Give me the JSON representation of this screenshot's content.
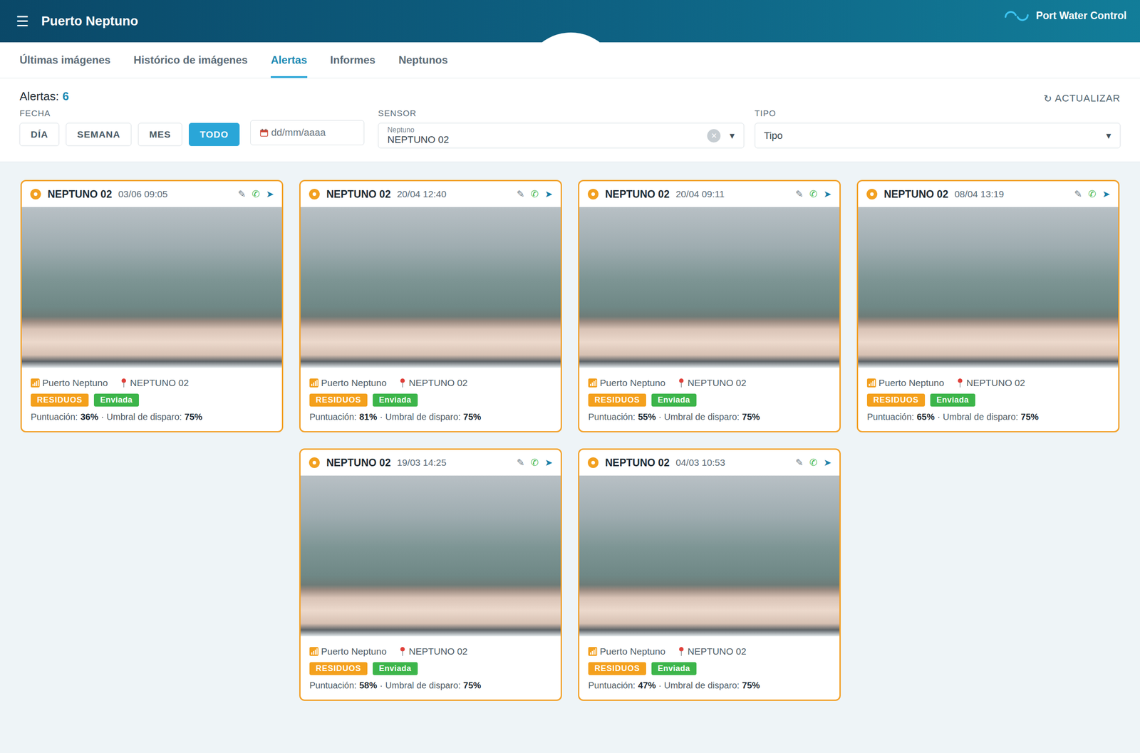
{
  "header": {
    "menu_icon": "☰",
    "title": "Puerto Neptuno",
    "brand": "Port Water Control"
  },
  "tabs": [
    {
      "label": "Últimas imágenes",
      "selected": false
    },
    {
      "label": "Histórico de imágenes",
      "selected": false
    },
    {
      "label": "Alertas",
      "selected": true
    },
    {
      "label": "Informes",
      "selected": false
    },
    {
      "label": "Neptunos",
      "selected": false
    }
  ],
  "summary": {
    "label": "Alertas:",
    "count": "6"
  },
  "refresh": {
    "icon": "↻",
    "label": "ACTUALIZAR"
  },
  "filters": {
    "date": {
      "label": "FECHA",
      "ranges": [
        {
          "label": "DÍA",
          "selected": false
        },
        {
          "label": "SEMANA",
          "selected": false
        },
        {
          "label": "MES",
          "selected": false
        },
        {
          "label": "TODO",
          "selected": true
        }
      ],
      "placeholder": "dd/mm/aaaa"
    },
    "sensor": {
      "label": "SENSOR",
      "field_label": "Neptuno",
      "value": "NEPTUNO 02",
      "clear_icon": "×",
      "arrow": "▾"
    },
    "type": {
      "label": "TIPO",
      "placeholder": "Tipo",
      "arrow": "▾"
    }
  },
  "card_labels": {
    "score": "Puntuación:",
    "separator": "·",
    "threshold": "Umbral de disparo:"
  },
  "card_actions": [
    {
      "icon": "✎",
      "color": "#6b7a86"
    },
    {
      "icon": "✆",
      "color": "#3cb54a"
    },
    {
      "icon": "➤",
      "color": "#1a7fa8"
    }
  ],
  "alerts": [
    {
      "sensor": "NEPTUNO 02",
      "time": "03/06 09:05",
      "port": "Puerto Neptuno",
      "location": "NEPTUNO 02",
      "type": "RESIDUOS",
      "status": "Enviada",
      "score": "36%",
      "threshold": "75%"
    },
    {
      "sensor": "NEPTUNO 02",
      "time": "20/04 12:40",
      "port": "Puerto Neptuno",
      "location": "NEPTUNO 02",
      "type": "RESIDUOS",
      "status": "Enviada",
      "score": "81%",
      "threshold": "75%"
    },
    {
      "sensor": "NEPTUNO 02",
      "time": "20/04 09:11",
      "port": "Puerto Neptuno",
      "location": "NEPTUNO 02",
      "type": "RESIDUOS",
      "status": "Enviada",
      "score": "55%",
      "threshold": "75%"
    },
    {
      "sensor": "NEPTUNO 02",
      "time": "08/04 13:19",
      "port": "Puerto Neptuno",
      "location": "NEPTUNO 02",
      "type": "RESIDUOS",
      "status": "Enviada",
      "score": "65%",
      "threshold": "75%"
    },
    {
      "sensor": "NEPTUNO 02",
      "time": "19/03 14:25",
      "port": "Puerto Neptuno",
      "location": "NEPTUNO 02",
      "type": "RESIDUOS",
      "status": "Enviada",
      "score": "58%",
      "threshold": "75%"
    },
    {
      "sensor": "NEPTUNO 02",
      "time": "04/03 10:53",
      "port": "Puerto Neptuno",
      "location": "NEPTUNO 02",
      "type": "RESIDUOS",
      "status": "Enviada",
      "score": "47%",
      "threshold": "75%"
    }
  ]
}
